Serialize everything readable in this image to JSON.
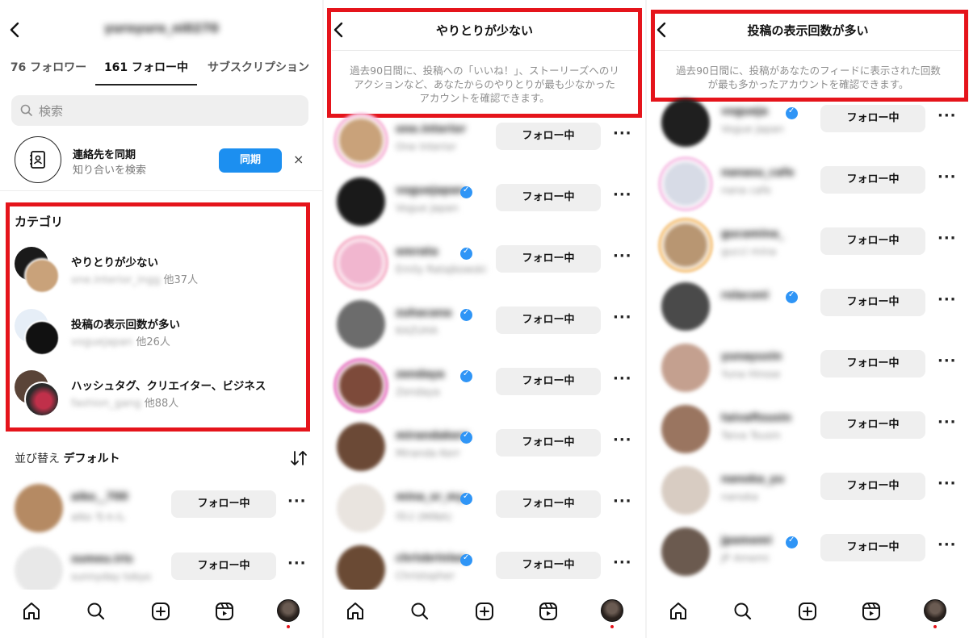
{
  "screen1": {
    "username": "yuroyuro_ni0270",
    "tabs": [
      "76 フォロワー",
      "161 フォロー中",
      "サブスクリプション"
    ],
    "search_placeholder": "検索",
    "sync": {
      "title": "連絡先を同期",
      "subtitle": "知り合いを検索",
      "button": "同期",
      "close": "×"
    },
    "category_title": "カテゴリ",
    "categories": [
      {
        "name": "やりとりが少ない",
        "sub_blur": "one.interior_ingg",
        "sub_count": "他37人"
      },
      {
        "name": "投稿の表示回数が多い",
        "sub_blur": "voguejapan",
        "sub_count": "他26人"
      },
      {
        "name": "ハッシュタグ、クリエイター、ビジネス",
        "sub_blur": "fashion_gang",
        "sub_count": "他88人"
      }
    ],
    "sort_prefix": "並び替え",
    "sort_value": "デフォルト",
    "rows": [
      {
        "username": "aiko__700",
        "fullname": "aiko ちゃん",
        "button": "フォロー中",
        "color": "#b58a63"
      },
      {
        "username": "sumeu.iris",
        "fullname": "sunnyday tokyo",
        "button": "フォロー中",
        "color": "#e8e8e8"
      }
    ]
  },
  "screen2": {
    "title": "やりとりが少ない",
    "description": [
      "過去90日間に、投稿への「いいね！」、ストーリーズへのリ",
      "アクションなど、あなたからのやりとりが最も少なかった",
      "アカウントを確認できます。"
    ],
    "rows": [
      {
        "username": "one.interior",
        "fullname": "One Interior",
        "verified": false,
        "button": "フォロー中",
        "color": "#c9a27a",
        "ring": "#f7b6d8"
      },
      {
        "username": "voguejapan",
        "fullname": "Vogue Japan",
        "verified": true,
        "button": "フォロー中",
        "color": "#1a1a1a",
        "ring": ""
      },
      {
        "username": "emrata",
        "fullname": "Emily Ratajkowski",
        "verified": true,
        "button": "フォロー中",
        "color": "#f1b6cf",
        "ring": "#f5b0c8"
      },
      {
        "username": "zuhacana",
        "fullname": "KAZUHA",
        "verified": true,
        "button": "フォロー中",
        "color": "#6c6c6c",
        "ring": ""
      },
      {
        "username": "zendaya",
        "fullname": "Zendaya",
        "verified": true,
        "button": "フォロー中",
        "color": "#7d4a3a",
        "ring": "#e87bc4"
      },
      {
        "username": "mirandakerr",
        "fullname": "Miranda Kerr",
        "verified": true,
        "button": "フォロー中",
        "color": "#6b4936",
        "ring": ""
      },
      {
        "username": "mina_sr_my",
        "fullname": "미나 (MINA)",
        "verified": true,
        "button": "フォロー中",
        "color": "#e9e4df",
        "ring": ""
      },
      {
        "username": "chrisbrinlee",
        "fullname": "Christopher",
        "verified": true,
        "button": "フォロー中",
        "color": "#6a4a34",
        "ring": ""
      }
    ]
  },
  "screen3": {
    "title": "投稿の表示回数が多い",
    "description": [
      "過去90日間に、投稿があなたのフィードに表示された回数",
      "が最も多かったアカウントを確認できます。"
    ],
    "rows": [
      {
        "username": "vogueja",
        "fullname": "Vogue Japan",
        "verified": true,
        "button": "フォロー中",
        "color": "#1f1f1f",
        "ring": ""
      },
      {
        "username": "nanasu_cafe",
        "fullname": "nana cafe",
        "verified": false,
        "button": "フォロー中",
        "color": "#d7dbe6",
        "ring": "#f7c2e6"
      },
      {
        "username": "gucamina_",
        "fullname": "gucci mina",
        "verified": false,
        "button": "フォロー中",
        "color": "#b89672",
        "ring": "#f5c27a"
      },
      {
        "username": "rolaconi",
        "fullname": "",
        "verified": true,
        "button": "フォロー中",
        "color": "#4a4a4a",
        "ring": ""
      },
      {
        "username": "yunayuxin",
        "fullname": "Yuna Hirose",
        "verified": false,
        "button": "フォロー中",
        "color": "#c4a08f",
        "ring": ""
      },
      {
        "username": "taivaftsusin",
        "fullname": "Taiva Tsusin",
        "verified": false,
        "button": "フォロー中",
        "color": "#9a7560",
        "ring": ""
      },
      {
        "username": "nanoka_yu",
        "fullname": "nanoka",
        "verified": false,
        "button": "フォロー中",
        "color": "#d8ccc2",
        "ring": ""
      },
      {
        "username": "jpamemi",
        "fullname": "JP Amemi",
        "verified": true,
        "button": "フォロー中",
        "color": "#6b5a4f",
        "ring": ""
      }
    ]
  },
  "icons": {
    "back": "chevron-left-icon",
    "home": "home-icon",
    "search": "search-icon",
    "create": "plus-square-icon",
    "reels": "reels-icon",
    "profile": "profile-avatar",
    "more": "more-horizontal-icon"
  },
  "colors": {
    "highlight": "#e5141b",
    "primary_button": "#1c8ff0",
    "verified": "#2f95f6"
  },
  "more_glyph": "···"
}
